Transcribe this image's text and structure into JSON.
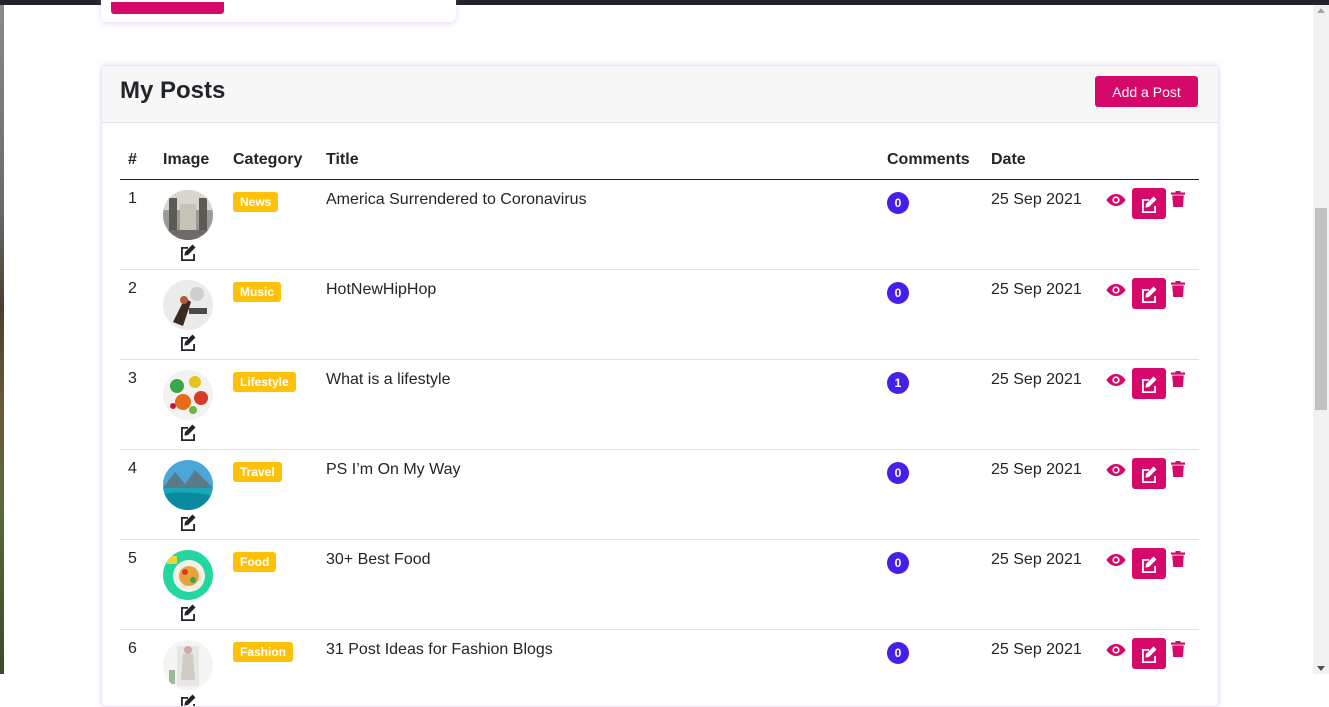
{
  "card": {
    "title": "My Posts",
    "add_button_label": "Add a Post"
  },
  "table": {
    "headers": {
      "num": "#",
      "image": "Image",
      "category": "Category",
      "title": "Title",
      "comments": "Comments",
      "date": "Date"
    },
    "rows": [
      {
        "num": "1",
        "category": "News",
        "title": "America Surrendered to Coronavirus",
        "comments": "0",
        "date": "25 Sep 2021",
        "thumb": "city-street-photo"
      },
      {
        "num": "2",
        "category": "Music",
        "title": "HotNewHipHop",
        "comments": "0",
        "date": "25 Sep 2021",
        "thumb": "music-photo"
      },
      {
        "num": "3",
        "category": "Lifestyle",
        "title": "What is a lifestyle",
        "comments": "1",
        "date": "25 Sep 2021",
        "thumb": "fruits-photo"
      },
      {
        "num": "4",
        "category": "Travel",
        "title": "PS I’m On My Way",
        "comments": "0",
        "date": "25 Sep 2021",
        "thumb": "lake-mountains-photo"
      },
      {
        "num": "5",
        "category": "Food",
        "title": "30+ Best Food",
        "comments": "0",
        "date": "25 Sep 2021",
        "thumb": "food-plate-photo"
      },
      {
        "num": "6",
        "category": "Fashion",
        "title": "31 Post Ideas for Fashion Blogs",
        "comments": "0",
        "date": "25 Sep 2021",
        "thumb": "fashion-photo"
      }
    ]
  },
  "colors": {
    "accent": "#d6096b",
    "category_badge": "#ffc107",
    "comment_badge": "#4620e8"
  },
  "icons": {
    "view": "eye-icon",
    "edit": "edit-icon",
    "delete": "trash-icon",
    "edit_image": "edit-image-icon"
  }
}
